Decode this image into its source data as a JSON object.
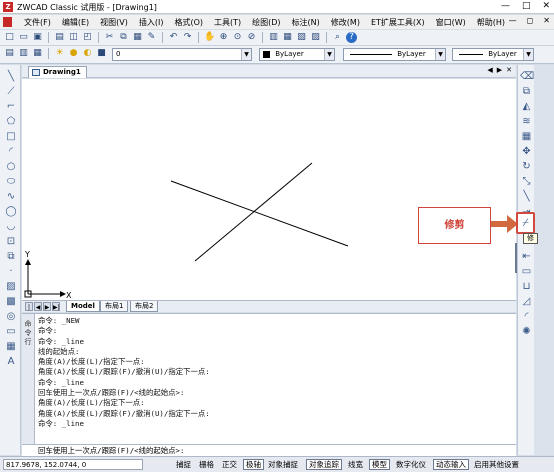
{
  "window": {
    "app_icon": "Z",
    "title": "ZWCAD Classic 试用版 - [Drawing1]",
    "minimize": "—",
    "maximize": "□",
    "close": "✕"
  },
  "menu": {
    "items": [
      "文件(F)",
      "编辑(E)",
      "视图(V)",
      "插入(I)",
      "格式(O)",
      "工具(T)",
      "绘图(D)",
      "标注(N)",
      "修改(M)",
      "ET扩展工具(X)",
      "窗口(W)",
      "帮助(H)"
    ],
    "mdi_minimize": "—",
    "mdi_restore": "◻",
    "mdi_close": "✕"
  },
  "toolbar": {
    "layer_value": "0",
    "color_value": "ByLayer",
    "linetype_value": "ByLayer",
    "lineweight_value": "ByLayer"
  },
  "drawing_tab": {
    "label": "Drawing1",
    "nav_left": "◀",
    "nav_right": "▶",
    "close": "✕"
  },
  "layout_tabs": {
    "model": "Model",
    "layout1": "布局1",
    "layout2": "布局2"
  },
  "canvas": {
    "ucs_y_label": "Y",
    "ucs_x_label": "X"
  },
  "command": {
    "handle_label": "命令行",
    "history": [
      "命令: _NEW",
      "命令:",
      "命令: _line",
      "线的起始点:",
      "角度(A)/长度(L)/指定下一点:",
      "角度(A)/长度(L)/跟踪(F)/撤消(U)/指定下一点:",
      "命令: _line",
      "回车使用上一次点/跟踪(F)/<线的起始点>:",
      "角度(A)/长度(L)/指定下一点:",
      "角度(A)/长度(L)/跟踪(F)/撤消(U)/指定下一点:",
      "命令: _line"
    ],
    "current_prompt": "回车使用上一次点/跟踪(F)/<线的起始点>:"
  },
  "status": {
    "coordinates": "817.9678, 152.0744, 0",
    "buttons": [
      "捕捉",
      "栅格",
      "正交",
      "极轴",
      "对象捕捉",
      "对象追踪",
      "线宽",
      "模型",
      "数字化仪",
      "动态输入",
      "启用其他设置"
    ],
    "active_buttons": [
      "极轴",
      "对象追踪",
      "模型",
      "动态输入"
    ]
  },
  "annotation": {
    "callout_text": "修剪",
    "tooltip_text": "修剪",
    "highlight_color": "#d24a3e"
  }
}
